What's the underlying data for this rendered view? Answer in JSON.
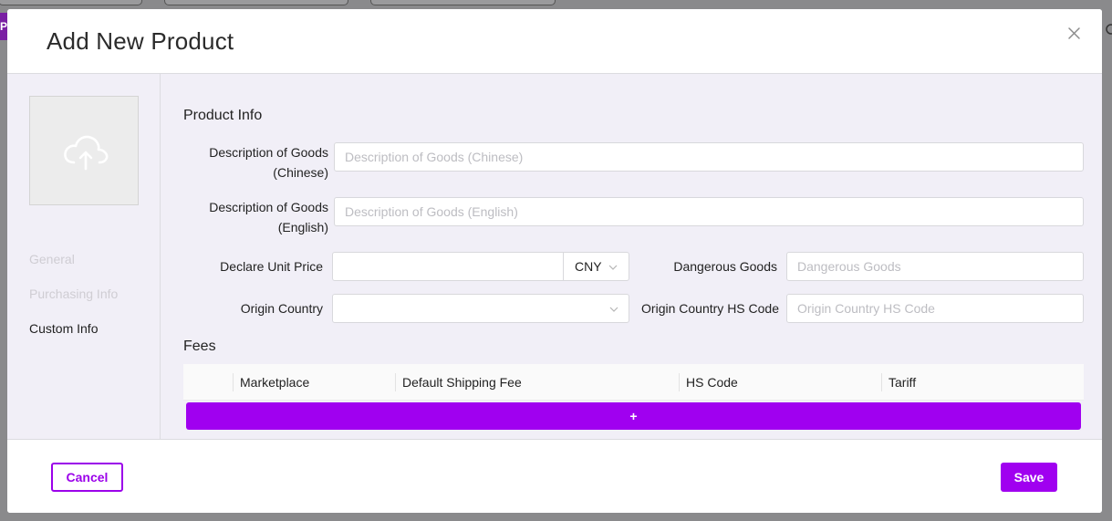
{
  "backdrop": {
    "badge_text": "P",
    "right_icon": "user-icon"
  },
  "modal": {
    "title": "Add New Product",
    "close_icon": "close-icon"
  },
  "sidebar": {
    "upload_icon": "cloud-upload-icon",
    "items": [
      {
        "label": "General",
        "active": false
      },
      {
        "label": "Purchasing Info",
        "active": false
      },
      {
        "label": "Custom Info",
        "active": true
      }
    ]
  },
  "product_info": {
    "heading": "Product Info",
    "desc_cn": {
      "label_line1": "Description of Goods",
      "label_line2": "(Chinese)",
      "placeholder": "Description of Goods (Chinese)",
      "value": ""
    },
    "desc_en": {
      "label_line1": "Description of Goods",
      "label_line2": "(English)",
      "placeholder": "Description of Goods (English)",
      "value": ""
    },
    "declare_price": {
      "label": "Declare Unit Price",
      "value": "",
      "currency": "CNY"
    },
    "dangerous_goods": {
      "label": "Dangerous Goods",
      "placeholder": "Dangerous Goods",
      "value": ""
    },
    "origin_country": {
      "label": "Origin Country",
      "value": ""
    },
    "origin_hs_code": {
      "label": "Origin Country HS Code",
      "placeholder": "Origin Country HS Code",
      "value": ""
    }
  },
  "fees": {
    "heading": "Fees",
    "columns": [
      "",
      "Marketplace",
      "Default Shipping Fee",
      "HS Code",
      "Tariff"
    ],
    "add_label": "+"
  },
  "footer": {
    "cancel_label": "Cancel",
    "save_label": "Save"
  },
  "colors": {
    "accent": "#a000f0",
    "body_bg": "#f1eff7",
    "overlay": "#8a8a8c"
  }
}
